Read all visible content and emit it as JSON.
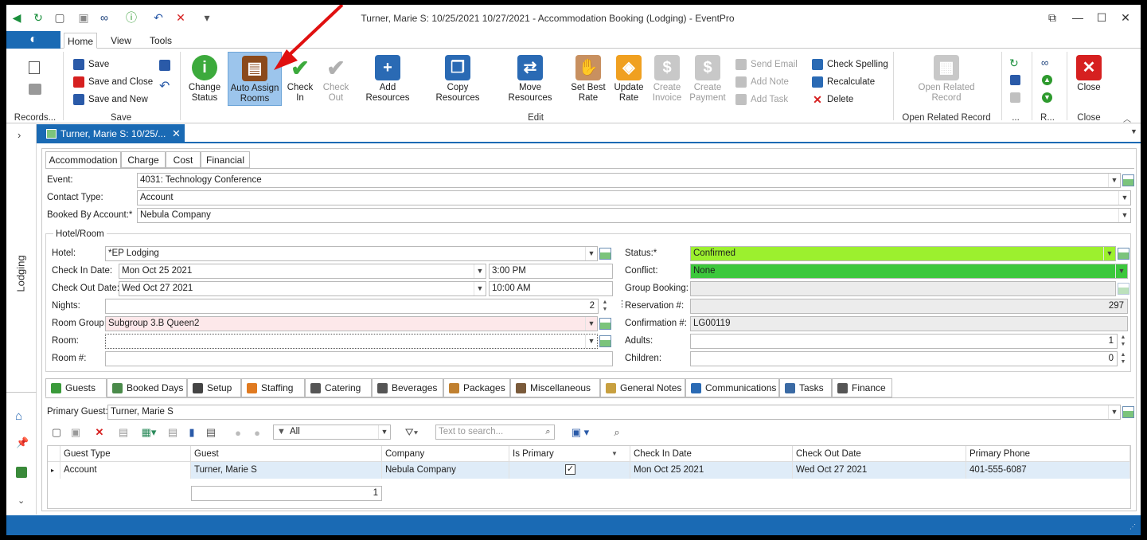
{
  "window": {
    "title": "Turner, Marie S:  10/25/2021 10/27/2021  - Accommodation Booking (Lodging) - EventPro",
    "buttons": {
      "restore": "⧉",
      "minimize": "—",
      "maximize": "☐",
      "close": "✕"
    }
  },
  "quick_access": [
    {
      "name": "back-icon",
      "glyph": "◀",
      "color": "#1a8f3c"
    },
    {
      "name": "refresh-icon",
      "glyph": "↻",
      "color": "#1a8f3c"
    },
    {
      "name": "new-record-icon",
      "glyph": "▢",
      "color": "#555"
    },
    {
      "name": "copy-icon",
      "glyph": "▣",
      "color": "#888"
    },
    {
      "name": "binoculars-icon",
      "glyph": "∞",
      "color": "#1a3f7a"
    },
    {
      "name": "info-icon",
      "glyph": "ⓘ",
      "color": "#2e9a2e"
    },
    {
      "name": "undo-icon",
      "glyph": "↶",
      "color": "#2a5aa8"
    },
    {
      "name": "delete-icon",
      "glyph": "✕",
      "color": "#d62020"
    },
    {
      "name": "customize-icon",
      "glyph": "▾",
      "color": "#555"
    }
  ],
  "ribbon_tabs": [
    "Home",
    "View",
    "Tools"
  ],
  "ribbon": {
    "records_group": "Records...",
    "save_group": {
      "label": "Save",
      "save": "Save",
      "save_close": "Save and Close",
      "save_new": "Save and New"
    },
    "edit_group": {
      "label": "Edit",
      "change_status": "Change Status",
      "auto_assign": "Auto Assign Rooms",
      "check_in": "Check In",
      "check_out": "Check Out",
      "add_resources": "Add Resources",
      "copy_resources": "Copy Resources",
      "move_resources": "Move Resources",
      "set_best_rate": "Set Best Rate",
      "update_rate": "Update Rate",
      "create_invoice": "Create Invoice",
      "create_payment": "Create Payment",
      "send_email": "Send Email",
      "add_note": "Add Note",
      "add_task": "Add Task",
      "check_spelling": "Check Spelling",
      "recalculate": "Recalculate",
      "delete": "Delete"
    },
    "open_related_group": {
      "label": "Open Related Record",
      "button": "Open Related Record"
    },
    "more_group": "...",
    "r_group": "R...",
    "close_group": {
      "label": "Close",
      "button": "Close"
    }
  },
  "left_nav": {
    "label": "Lodging"
  },
  "doc_tab": {
    "label": "Turner, Marie S:  10/25/..."
  },
  "form_tabs": [
    "Accommodation",
    "Charge",
    "Cost",
    "Financial"
  ],
  "form": {
    "event": {
      "label": "Event:",
      "value": "4031: Technology Conference"
    },
    "contact_type": {
      "label": "Contact Type:",
      "value": "Account"
    },
    "booked_by": {
      "label": "Booked By Account:*",
      "value": "Nebula Company"
    },
    "hotel_room_group": "Hotel/Room",
    "hotel": {
      "label": "Hotel:",
      "value": "*EP Lodging"
    },
    "check_in_date": {
      "label": "Check In Date:",
      "value": "Mon Oct 25 2021",
      "time": "3:00 PM"
    },
    "check_out_date": {
      "label": "Check Out Date:",
      "value": "Wed Oct 27 2021",
      "time": "10:00 AM"
    },
    "nights": {
      "label": "Nights:",
      "value": "2"
    },
    "room_group": {
      "label": "Room Group:",
      "value": "Subgroup 3.B Queen2"
    },
    "room": {
      "label": "Room:",
      "value": ""
    },
    "room_number": {
      "label": "Room #:",
      "value": ""
    },
    "status": {
      "label": "Status:*",
      "value": "Confirmed",
      "color": "#9cf02e"
    },
    "conflict": {
      "label": "Conflict:",
      "value": "None",
      "color": "#3cc83c"
    },
    "group_booking": {
      "label": "Group Booking:",
      "value": ""
    },
    "reservation": {
      "label": "Reservation #:",
      "value": "297"
    },
    "confirmation": {
      "label": "Confirmation #:",
      "value": "LG00119"
    },
    "adults": {
      "label": "Adults:",
      "value": "1"
    },
    "children": {
      "label": "Children:",
      "value": "0"
    }
  },
  "bottom_tabs": [
    {
      "label": "Guests",
      "icon": "guest-icon",
      "color": "#3a9a3a"
    },
    {
      "label": "Booked Days",
      "icon": "calendar-icon",
      "color": "#4a8a4a"
    },
    {
      "label": "Setup",
      "icon": "table-setup-icon",
      "color": "#444"
    },
    {
      "label": "Staffing",
      "icon": "staff-icon",
      "color": "#e07a20"
    },
    {
      "label": "Catering",
      "icon": "utensils-icon",
      "color": "#555"
    },
    {
      "label": "Beverages",
      "icon": "glass-icon",
      "color": "#555"
    },
    {
      "label": "Packages",
      "icon": "package-icon",
      "color": "#c08030"
    },
    {
      "label": "Miscellaneous",
      "icon": "misc-icon",
      "color": "#7a5a3a"
    },
    {
      "label": "General Notes",
      "icon": "notes-icon",
      "color": "#c8a040"
    },
    {
      "label": "Communications",
      "icon": "chat-icon",
      "color": "#2a6ab4"
    },
    {
      "label": "Tasks",
      "icon": "tasks-icon",
      "color": "#3a6aa4"
    },
    {
      "label": "Finance",
      "icon": "finance-icon",
      "color": "#555"
    }
  ],
  "guests": {
    "primary_label": "Primary Guest:",
    "primary_value": "Turner, Marie S",
    "filter_value": "All",
    "search_placeholder": "Text to search...",
    "columns": [
      "Guest Type",
      "Guest",
      "Company",
      "Is Primary",
      "Check In Date",
      "Check Out Date",
      "Primary Phone"
    ],
    "rows": [
      {
        "guest_type": "Account",
        "guest": "Turner, Marie S",
        "company": "Nebula Company",
        "is_primary": true,
        "check_in": "Mon Oct 25 2021",
        "check_out": "Wed Oct 27 2021",
        "phone": "401-555-6087"
      }
    ],
    "count": "1"
  }
}
